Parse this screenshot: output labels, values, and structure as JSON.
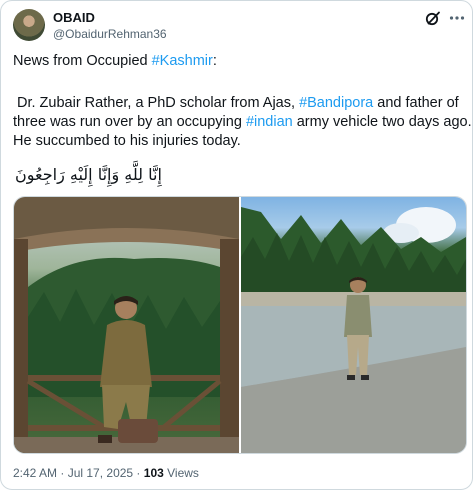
{
  "author": {
    "name": "OBAID",
    "handle": "@ObaidurRehman36"
  },
  "icons": {
    "grok": "grok-icon",
    "more": "more-icon"
  },
  "tweet": {
    "line1_prefix": "News from Occupied ",
    "line1_link": "#Kashmir",
    "line1_suffix": ":",
    "line2_prefix": "Dr. Zubair Rather, a PhD scholar from Ajas, ",
    "line2_link": "#Bandipora",
    "line2_suffix": " and father of",
    "line3_prefix": "three was run over by an occupying ",
    "line3_link": "#indian",
    "line3_suffix": " army vehicle two days ago.",
    "line4": "He succumbed to his injuries today.",
    "arabic": "إِنَّا لِلَّهِ وَإِنَّا إِلَيْهِ رَاجِعُونَ"
  },
  "media": [
    {
      "alt": "man seated on a wooden railing under a gazebo with forested hills behind"
    },
    {
      "alt": "man standing on a rocky riverbank with pine forest and blue sky"
    }
  ],
  "footer": {
    "time": "2:42 AM",
    "separator1": " · ",
    "date": "Jul 17, 2025",
    "separator2": " · ",
    "views_count": "103",
    "views_label": " Views"
  },
  "colors": {
    "link": "#1d9bf0",
    "text": "#0f1419",
    "muted": "#536471",
    "border": "#cfd9de"
  }
}
